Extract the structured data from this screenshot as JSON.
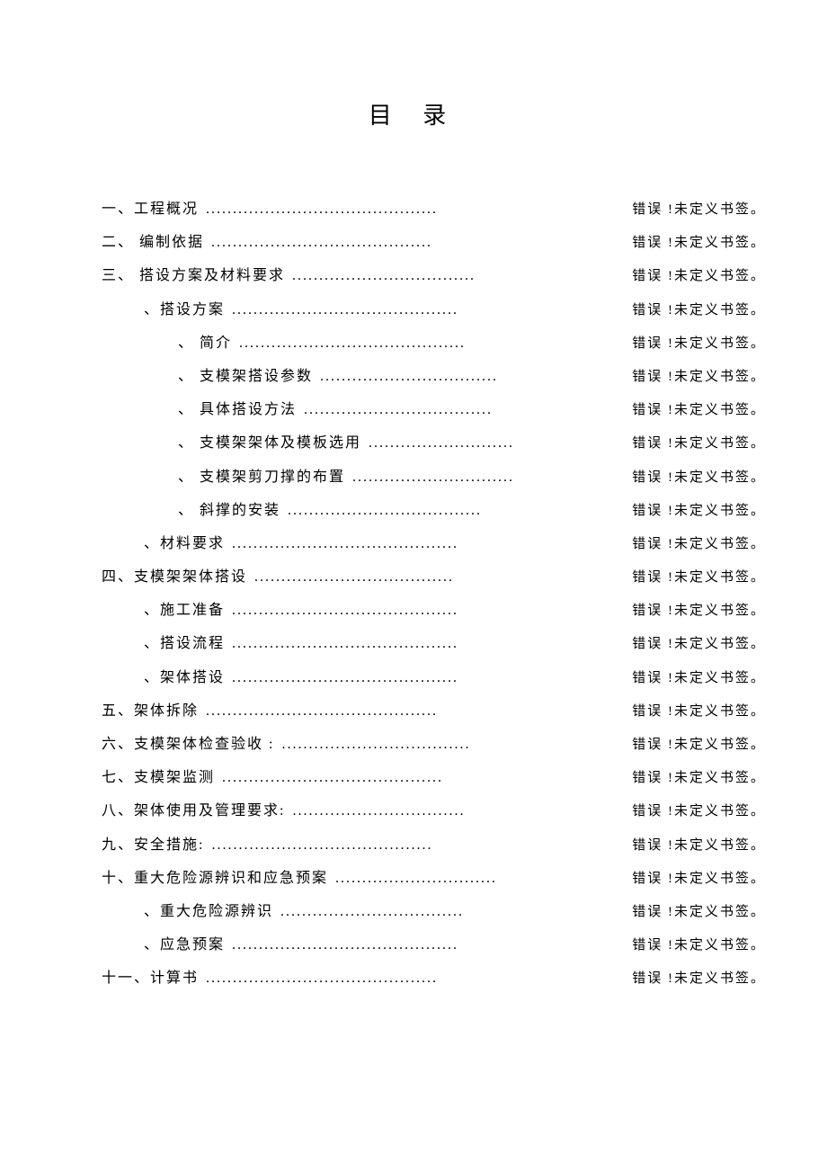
{
  "title": "目 录",
  "error_text": "错误 !未定义书签。",
  "entries": [
    {
      "label": "一、工程概况",
      "indent": 0,
      "leader": "...........................................",
      "gap": false
    },
    {
      "label": "二、 编制依据",
      "indent": 0,
      "leader": ".........................................",
      "gap": false
    },
    {
      "label": "三、 搭设方案及材料要求",
      "indent": 0,
      "leader": "..................................",
      "gap": false
    },
    {
      "label": "、搭设方案",
      "indent": 1,
      "leader": "..........................................",
      "gap": false
    },
    {
      "label": "、 简介",
      "indent": 2,
      "leader": "..........................................",
      "gap": false
    },
    {
      "label": "、 支模架搭设参数",
      "indent": 2,
      "leader": ".................................",
      "gap": false
    },
    {
      "label": "、 具体搭设方法",
      "indent": 2,
      "leader": "...................................",
      "gap": false
    },
    {
      "label": "、 支模架架体及模板选用",
      "indent": 2,
      "leader": "...........................",
      "gap": false
    },
    {
      "label": "、 支模架剪刀撑的布置",
      "indent": 2,
      "leader": "..............................",
      "gap": false
    },
    {
      "label": "、 斜撑的安装",
      "indent": 2,
      "leader": "....................................",
      "gap": false
    },
    {
      "label": "、材料要求",
      "indent": 1,
      "leader": "..........................................",
      "gap": false
    },
    {
      "label": "四、支模架架体搭设",
      "indent": 0,
      "leader": ".....................................",
      "gap": false
    },
    {
      "label": "、施工准备",
      "indent": 1,
      "leader": "..........................................",
      "gap": false
    },
    {
      "label": "、搭设流程",
      "indent": 1,
      "leader": "..........................................",
      "gap": false
    },
    {
      "label": "、架体搭设",
      "indent": 1,
      "leader": "..........................................",
      "gap": false
    },
    {
      "label": "五、架体拆除",
      "indent": 0,
      "leader": "...........................................",
      "gap": false
    },
    {
      "label": "六、支模架体检查验收  :",
      "indent": 0,
      "leader": "...................................",
      "gap": false
    },
    {
      "label": "七、支模架监测",
      "indent": 0,
      "leader": ".........................................",
      "gap": false
    },
    {
      "label": "八、架体使用及管理要求:",
      "indent": 0,
      "leader": "................................",
      "gap": false
    },
    {
      "label": "九、安全措施:",
      "indent": 0,
      "leader": ".........................................",
      "gap": false
    },
    {
      "label": "十、重大危险源辨识和应急预案",
      "indent": 0,
      "leader": "..............................",
      "gap": false
    },
    {
      "label": "、重大危险源辨识",
      "indent": 1,
      "leader": "..................................",
      "gap": false
    },
    {
      "label": "、应急预案",
      "indent": 1,
      "leader": "..........................................",
      "gap": false
    },
    {
      "label": "十一、计算书",
      "indent": 0,
      "leader": "...........................................",
      "gap": false
    }
  ]
}
